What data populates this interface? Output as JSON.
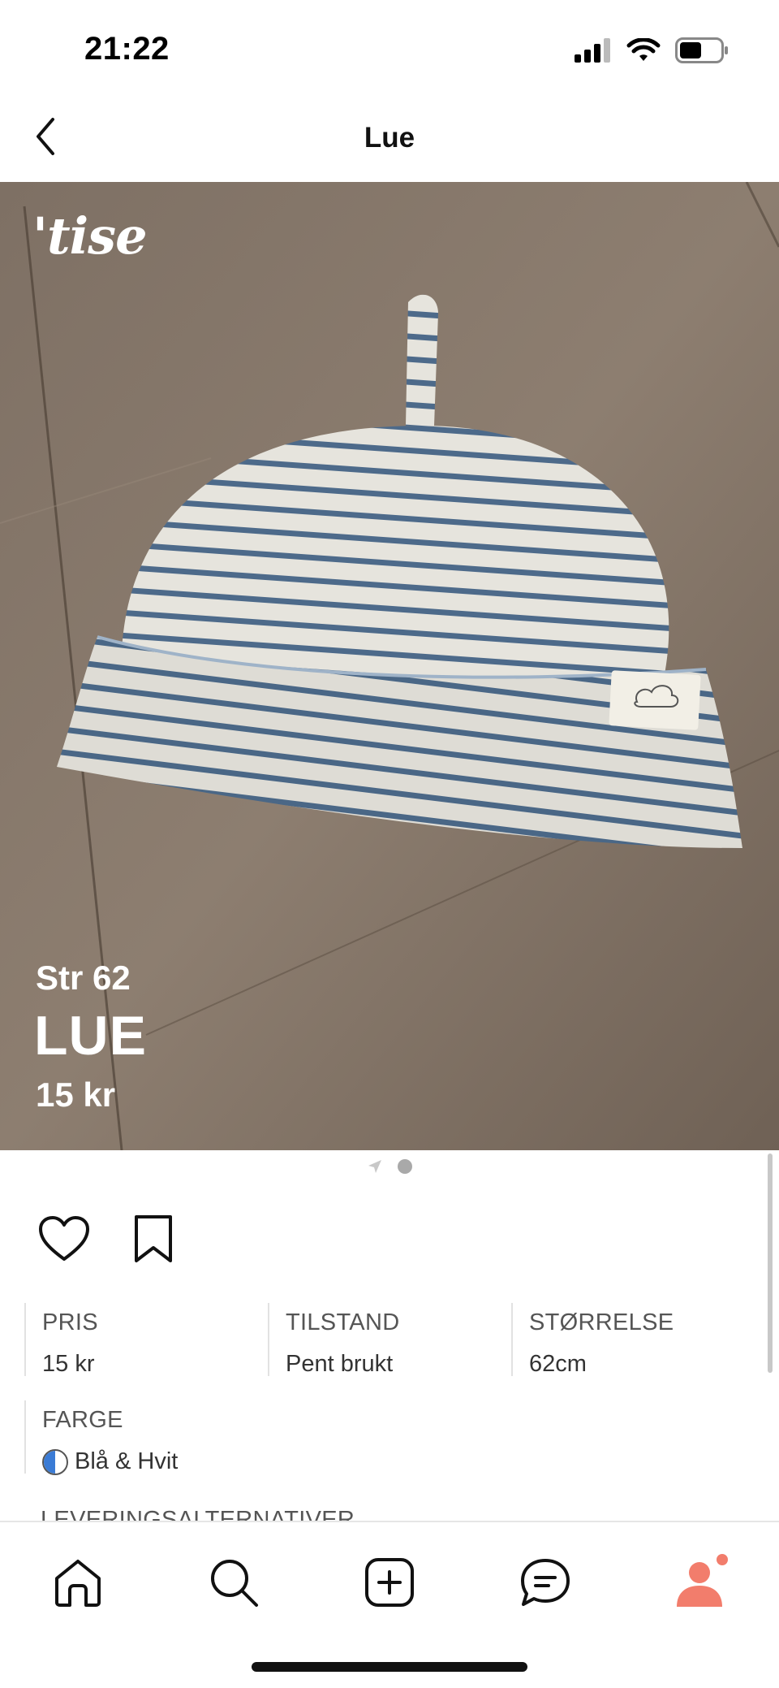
{
  "status_bar": {
    "time": "21:22"
  },
  "nav": {
    "title": "Lue"
  },
  "hero": {
    "brand": "'tise",
    "overlay_size": "Str 62",
    "overlay_name": "LUE",
    "overlay_price": "15 kr",
    "image_count": 2,
    "active_image": 1
  },
  "details": {
    "row1": [
      {
        "label": "PRIS",
        "value": "15 kr"
      },
      {
        "label": "TILSTAND",
        "value": "Pent brukt"
      },
      {
        "label": "STØRRELSE",
        "value": "62cm"
      }
    ],
    "color": {
      "label": "FARGE",
      "value": "Blå & Hvit"
    },
    "delivery_label": "LEVERINGSALTERNATIVER"
  },
  "tabs": [
    "home-tab",
    "search-tab",
    "add-listing-tab",
    "messages-tab",
    "profile-tab"
  ],
  "colors": {
    "accent": "#f27d6c",
    "notification": "#f27d6c",
    "swatch_blue": "#3a7bd5"
  }
}
